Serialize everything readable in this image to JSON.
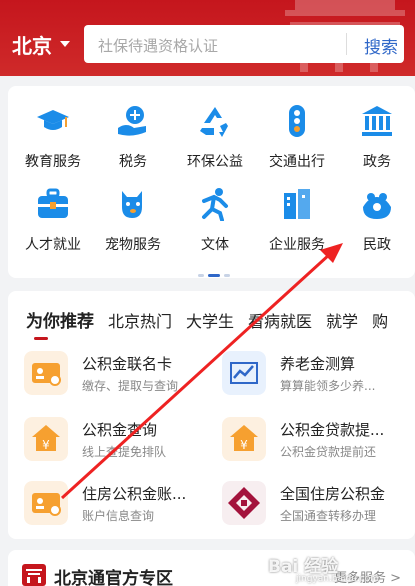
{
  "header": {
    "city": "北京",
    "search_placeholder": "社保待遇资格认证",
    "search_button": "搜索"
  },
  "services": [
    {
      "label": "教育服务",
      "icon": "graduation-cap-icon"
    },
    {
      "label": "税务",
      "icon": "tax-hand-icon"
    },
    {
      "label": "环保公益",
      "icon": "recycle-icon"
    },
    {
      "label": "交通出行",
      "icon": "traffic-light-icon"
    },
    {
      "label": "政务",
      "icon": "government-building-icon"
    },
    {
      "label": "人才就业",
      "icon": "briefcase-icon"
    },
    {
      "label": "宠物服务",
      "icon": "pet-icon"
    },
    {
      "label": "文体",
      "icon": "running-person-icon"
    },
    {
      "label": "企业服务",
      "icon": "office-building-icon"
    },
    {
      "label": "民政",
      "icon": "family-icon"
    }
  ],
  "recommend": {
    "tabs": [
      "为你推荐",
      "北京热门",
      "大学生",
      "看病就医",
      "就学",
      "购"
    ],
    "items": [
      {
        "title": "公积金联名卡",
        "sub": "缴存、提取与查询",
        "icon": "id-card-icon"
      },
      {
        "title": "养老金测算",
        "sub": "算算能领多少养...",
        "icon": "line-chart-icon"
      },
      {
        "title": "公积金查询",
        "sub": "线上查提免排队",
        "icon": "house-yuan-icon"
      },
      {
        "title": "公积金贷款提...",
        "sub": "公积金贷款提前还",
        "icon": "house-yuan-icon"
      },
      {
        "title": "住房公积金账...",
        "sub": "账户信息查询",
        "icon": "id-card-icon"
      },
      {
        "title": "全国住房公积金",
        "sub": "全国通查转移办理",
        "icon": "housing-fund-logo-icon"
      }
    ]
  },
  "beijing": {
    "title": "北京通官方专区",
    "more": "更多服务 >"
  },
  "watermark": {
    "text": "Bai 经验",
    "sub": "jingyan.baidu.com"
  },
  "colors": {
    "brand_red": "#c5161d",
    "link_blue": "#2f67c8",
    "icon_blue": "#1b8ce8",
    "icon_orange": "#f6a030",
    "annotation_red": "#ee2222"
  }
}
